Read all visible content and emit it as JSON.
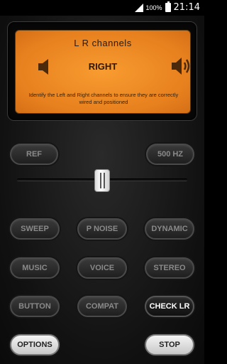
{
  "status_bar": {
    "battery_percent": "100%",
    "time": "21:14"
  },
  "display": {
    "title": "L R channels",
    "channel": "RIGHT",
    "description": "Identify the Left and Right channels to ensure they are correctly wired and positioned",
    "left_icon": "speaker-muted-icon",
    "right_icon": "speaker-sound-icon"
  },
  "top_buttons": {
    "ref": "REF",
    "freq": "500 HZ"
  },
  "slider": {
    "value_fraction": 0.5
  },
  "mode_buttons": [
    {
      "label": "SWEEP"
    },
    {
      "label": "P NOISE"
    },
    {
      "label": "DYNAMIC"
    },
    {
      "label": "MUSIC"
    },
    {
      "label": "VOICE"
    },
    {
      "label": "STEREO"
    },
    {
      "label": "BUTTON"
    },
    {
      "label": "COMPAT"
    },
    {
      "label": "CHECK LR"
    }
  ],
  "bottom_buttons": {
    "options": "OPTIONS",
    "stop": "STOP"
  },
  "colors": {
    "display_orange": "#f08a24",
    "background": "#111111"
  }
}
